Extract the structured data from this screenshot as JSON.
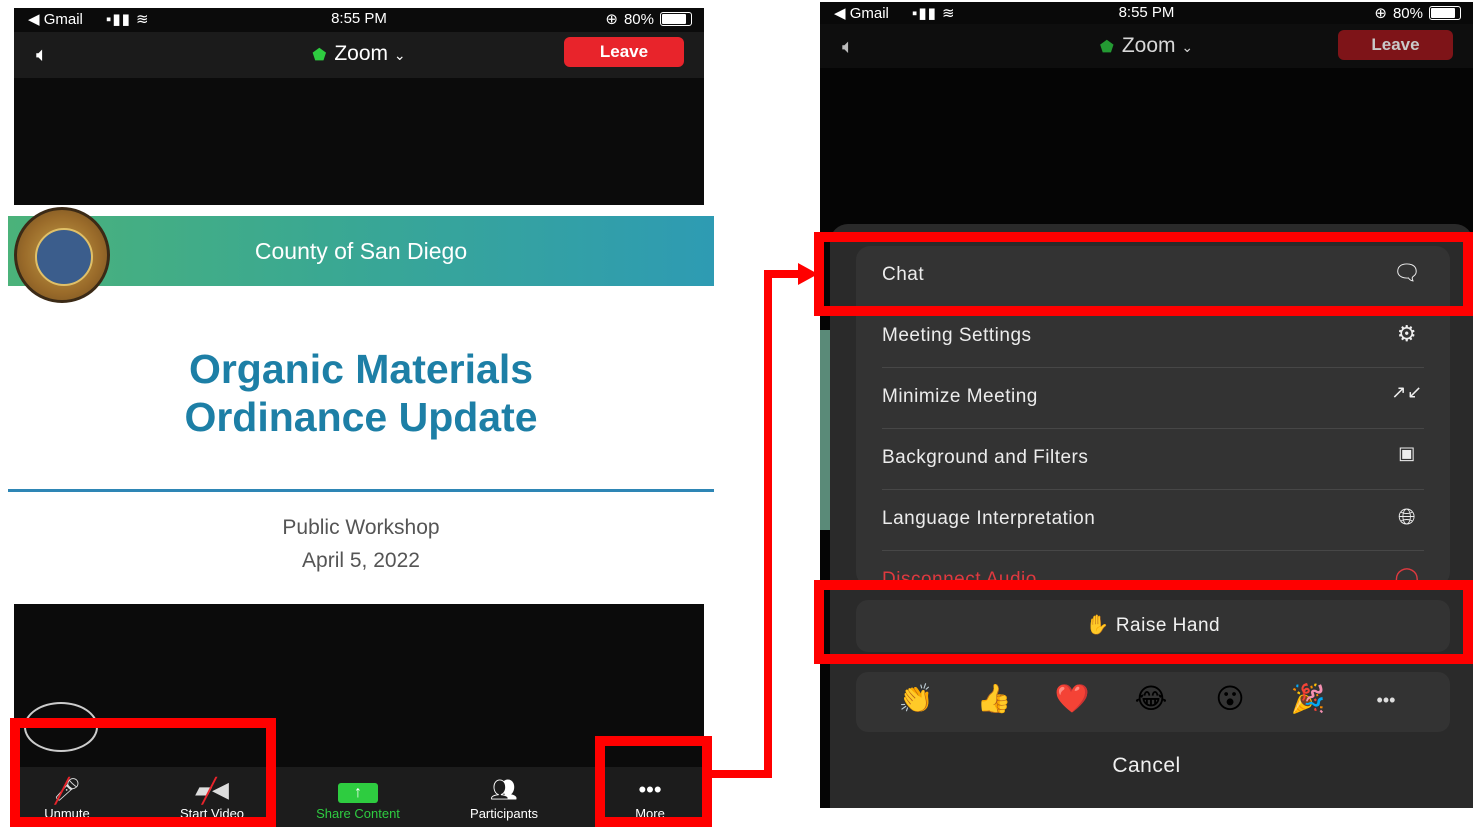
{
  "left_phone": {
    "status": {
      "carrier": "◀ Gmail",
      "time": "8:55 PM",
      "battery": "80%"
    },
    "header": {
      "title": "Zoom",
      "leave_label": "Leave"
    },
    "slide": {
      "banner": "County of San Diego",
      "title_line1": "Organic Materials",
      "title_line2": "Ordinance Update",
      "subtitle_line1": "Public Workshop",
      "subtitle_line2": "April 5, 2022"
    },
    "toolbar": [
      {
        "label": "Unmute",
        "icon": "mic-off-icon"
      },
      {
        "label": "Start Video",
        "icon": "video-off-icon"
      },
      {
        "label": "Share Content",
        "icon": "share-icon"
      },
      {
        "label": "Participants",
        "icon": "participants-icon"
      },
      {
        "label": "More",
        "icon": "more-icon"
      }
    ]
  },
  "right_phone": {
    "status": {
      "carrier": "◀ Gmail",
      "time": "8:55 PM",
      "battery": "80%"
    },
    "header": {
      "title": "Zoom",
      "leave_label": "Leave"
    },
    "menu": [
      {
        "label": "Chat",
        "icon": "chat-icon"
      },
      {
        "label": "Meeting Settings",
        "icon": "gear-icon"
      },
      {
        "label": "Minimize Meeting",
        "icon": "minimize-icon"
      },
      {
        "label": "Background and Filters",
        "icon": "background-icon"
      },
      {
        "label": "Language Interpretation",
        "icon": "globe-icon"
      },
      {
        "label": "Disconnect Audio",
        "icon": "disconnect-icon"
      }
    ],
    "raise_hand": "Raise Hand",
    "reactions": [
      "👏",
      "👍",
      "❤️",
      "😂",
      "😮",
      "🎉",
      "•••"
    ],
    "cancel_label": "Cancel"
  },
  "colors": {
    "highlight": "#ff0000",
    "leave": "#e8242b",
    "zoom_green": "#2ecc40",
    "slide_blue": "#1d7fa6"
  }
}
